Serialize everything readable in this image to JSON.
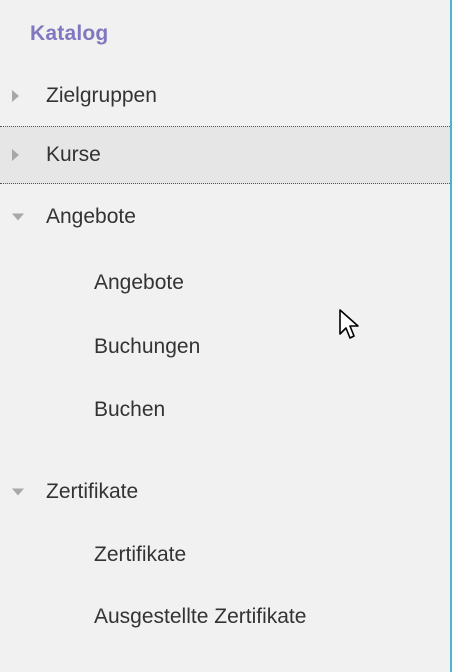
{
  "catalog": {
    "title": "Katalog",
    "items": [
      {
        "label": "Zielgruppen",
        "icon": "triangle-right-icon"
      },
      {
        "label": "Kurse",
        "icon": "triangle-right-icon"
      },
      {
        "label": "Angebote",
        "icon": "triangle-down-icon",
        "children": [
          "Angebote",
          "Buchungen",
          "Buchen"
        ]
      },
      {
        "label": "Zertifikate",
        "icon": "triangle-down-icon",
        "children": [
          "Zertifikate",
          "Ausgestellte Zertifikate"
        ]
      }
    ]
  },
  "colors": {
    "title": "#7f78c0",
    "panel_bg": "#f1f1f1",
    "hover_bg": "#e6e6e6",
    "border": "#4fb3c9",
    "triangle": "#a8a8a8"
  },
  "cursor_icon": "mouse-pointer-icon"
}
